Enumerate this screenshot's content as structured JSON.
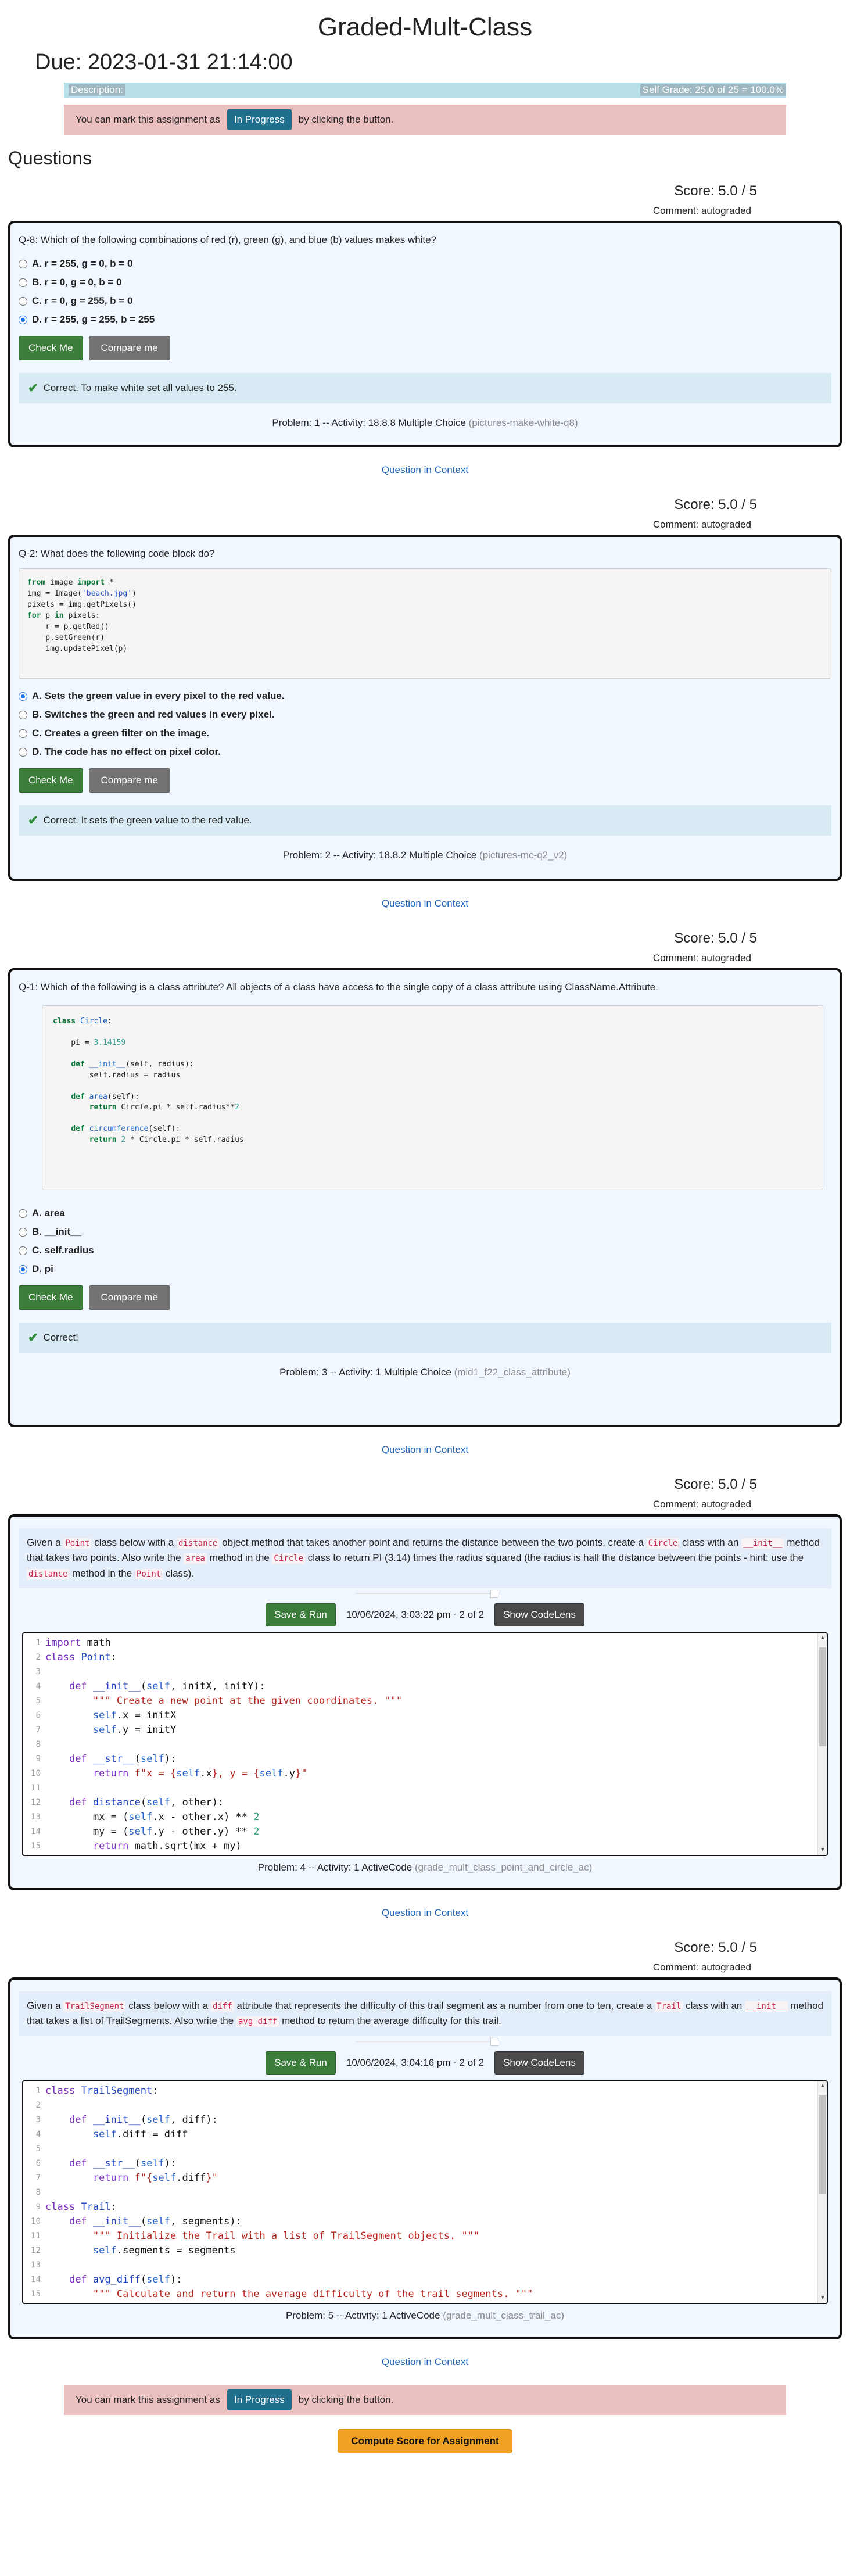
{
  "page": {
    "title": "Graded-Mult-Class",
    "due": "Due: 2023-01-31 21:14:00",
    "description_label": "Description:",
    "self_grade": "Self Grade: 25.0 of 25 = 100.0%",
    "status_prefix": "You can mark this assignment as",
    "status_button": "In Progress",
    "status_suffix": "by clicking the button.",
    "questions_heading": "Questions",
    "compute_button": "Compute Score for Assignment"
  },
  "questions": [
    {
      "score": "Score: 5.0 / 5",
      "comment": "Comment: autograded",
      "prompt": "Q-8: Which of the following combinations of red (r), green (g), and blue (b) values makes white?",
      "options": [
        "A. r = 255, g = 0, b = 0",
        "B. r = 0, g = 0, b = 0",
        "C. r = 0, g = 255, b = 0",
        "D. r = 255, g = 255, b = 255"
      ],
      "selected": 3,
      "check_label": "Check Me",
      "compare_label": "Compare me",
      "feedback": "Correct. To make white set all values to 255.",
      "problem": "Problem: 1 -- Activity: 18.8.8 Multiple Choice",
      "problem_id": "(pictures-make-white-q8)",
      "context_link": "Question in Context"
    },
    {
      "score": "Score: 5.0 / 5",
      "comment": "Comment: autograded",
      "prompt": "Q-2: What does the following code block do?",
      "options": [
        "A. Sets the green value in every pixel to the red value.",
        "B. Switches the green and red values in every pixel.",
        "C. Creates a green filter on the image.",
        "D. The code has no effect on pixel color."
      ],
      "selected": 0,
      "check_label": "Check Me",
      "compare_label": "Compare me",
      "feedback": "Correct. It sets the green value to the red value.",
      "problem": "Problem: 2 -- Activity: 18.8.2 Multiple Choice",
      "problem_id": "(pictures-mc-q2_v2)",
      "context_link": "Question in Context"
    },
    {
      "score": "Score: 5.0 / 5",
      "comment": "Comment: autograded",
      "prompt": "Q-1: Which of the following is a class attribute? All objects of a class have access to the single copy of a class attribute using ClassName.Attribute.",
      "options": [
        "A. area",
        "B. __init__",
        "C. self.radius",
        "D. pi"
      ],
      "selected": 3,
      "check_label": "Check Me",
      "compare_label": "Compare me",
      "feedback": "Correct!",
      "problem": "Problem: 3 -- Activity: 1 Multiple Choice",
      "problem_id": "(mid1_f22_class_attribute)",
      "context_link": "Question in Context"
    },
    {
      "score": "Score: 5.0 / 5",
      "comment": "Comment: autograded",
      "desc": {
        "t1": "Given a",
        "c1": "Point",
        "t2": "class below with a",
        "c2": "distance",
        "t3": "object method that takes another point and returns the distance between the two points, create a",
        "c3": "Circle",
        "t4": "class with an",
        "c4": "__init__",
        "t5": "method that takes two points. Also write the",
        "c5": "area",
        "t6": "method in the",
        "c6": "Circle",
        "t7": "class to return PI (3.14) times the radius squared (the radius is half the distance between the points - hint: use the",
        "c7": "distance",
        "t8": "method in the",
        "c8": "Point",
        "t9": "class)."
      },
      "run_label": "Save & Run",
      "timestamp": "10/06/2024, 3:03:22 pm - 2 of 2",
      "lens_label": "Show CodeLens",
      "problem": "Problem: 4 -- Activity: 1 ActiveCode",
      "problem_id": "(grade_mult_class_point_and_circle_ac)",
      "context_link": "Question in Context"
    },
    {
      "score": "Score: 5.0 / 5",
      "comment": "Comment: autograded",
      "desc": {
        "t1": "Given a",
        "c1": "TrailSegment",
        "t2": "class below with a",
        "c2": "diff",
        "t3": "attribute that represents the difficulty of this trail segment as a number from one to ten, create a",
        "c3": "Trail",
        "t4": "class with an",
        "c4": "__init__",
        "t5": "method that takes a list of TrailSegments. Also write the",
        "c5": "avg_diff",
        "t6": "method to return the average difficulty for this trail."
      },
      "run_label": "Save & Run",
      "timestamp": "10/06/2024, 3:04:16 pm - 2 of 2",
      "lens_label": "Show CodeLens",
      "problem": "Problem: 5 -- Activity: 1 ActiveCode",
      "problem_id": "(grade_mult_class_trail_ac)",
      "context_link": "Question in Context"
    }
  ]
}
